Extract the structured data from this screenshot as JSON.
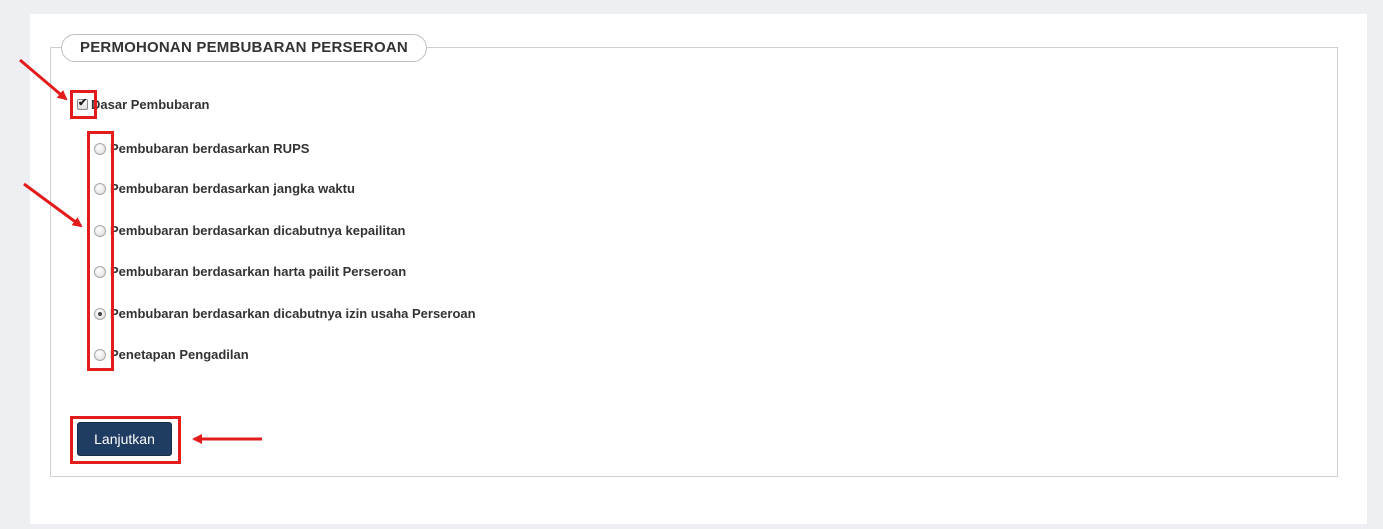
{
  "form": {
    "legend": "PERMOHONAN PEMBUBARAN PERSEROAN",
    "checkbox": {
      "label": "Dasar Pembubaran",
      "checked": true
    },
    "radio_options": [
      {
        "label": "Pembubaran berdasarkan RUPS",
        "checked": false
      },
      {
        "label": "Pembubaran berdasarkan jangka waktu",
        "checked": false
      },
      {
        "label": "Pembubaran berdasarkan dicabutnya kepailitan",
        "checked": false
      },
      {
        "label": "Pembubaran berdasarkan harta pailit Perseroan",
        "checked": false
      },
      {
        "label": "Pembubaran berdasarkan dicabutnya izin usaha Perseroan",
        "checked": true
      },
      {
        "label": "Penetapan Pengadilan",
        "checked": false
      }
    ],
    "submit_label": "Lanjutkan"
  },
  "colors": {
    "button_bg": "#1f3d63",
    "annotation_red": "#e21b1b",
    "page_bg": "#eeeff3"
  }
}
